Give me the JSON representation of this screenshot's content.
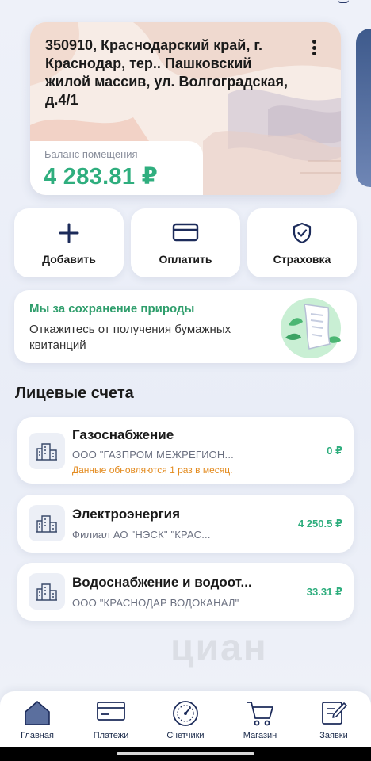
{
  "property": {
    "address": "350910, Краснодарский край, г. Краснодар, тер.. Пашковский жилой массив, ул. Волгоградская, д.4/1",
    "balance_label": "Баланс помещения",
    "balance_value": "4 283.81 ₽"
  },
  "actions": [
    {
      "label": "Добавить",
      "icon": "plus-icon"
    },
    {
      "label": "Оплатить",
      "icon": "credit-card-icon"
    },
    {
      "label": "Страховка",
      "icon": "shield-check-icon"
    }
  ],
  "eco_banner": {
    "title": "Мы за сохранение природы",
    "text": "Откажитесь от получения бумажных квитанций",
    "icon": "paper-receipt-leaves-icon"
  },
  "accounts_section": {
    "title": "Лицевые счета",
    "items": [
      {
        "name": "Газоснабжение",
        "org": "ООО \"ГАЗПРОМ МЕЖРЕГИОН...",
        "amount": "0 ₽",
        "note": "Данные обновляются 1 раз в месяц.",
        "icon": "building-icon"
      },
      {
        "name": "Электроэнергия",
        "org": "Филиал АО \"НЭСК\" \"КРАС...",
        "amount": "4 250.5 ₽",
        "note": "",
        "icon": "building-icon"
      },
      {
        "name": "Водоснабжение и водоот...",
        "org": "ООО \"КРАСНОДАР ВОДОКАНАЛ\"",
        "amount": "33.31 ₽",
        "note": "",
        "icon": "building-icon"
      }
    ]
  },
  "bottom_nav": [
    {
      "label": "Главная",
      "icon": "home-icon",
      "active": true
    },
    {
      "label": "Платежи",
      "icon": "payments-card-icon",
      "active": false
    },
    {
      "label": "Счетчики",
      "icon": "meter-gauge-icon",
      "active": false
    },
    {
      "label": "Магазин",
      "icon": "shopping-cart-icon",
      "active": false
    },
    {
      "label": "Заявки",
      "icon": "request-edit-icon",
      "active": false
    }
  ],
  "watermark": "циан",
  "colors": {
    "accent_green": "#2fae7e",
    "eco_green": "#2f9e6c",
    "warning_orange": "#e38a1d",
    "nav_dark": "#1a2a4a",
    "background": "#eef1f8"
  }
}
